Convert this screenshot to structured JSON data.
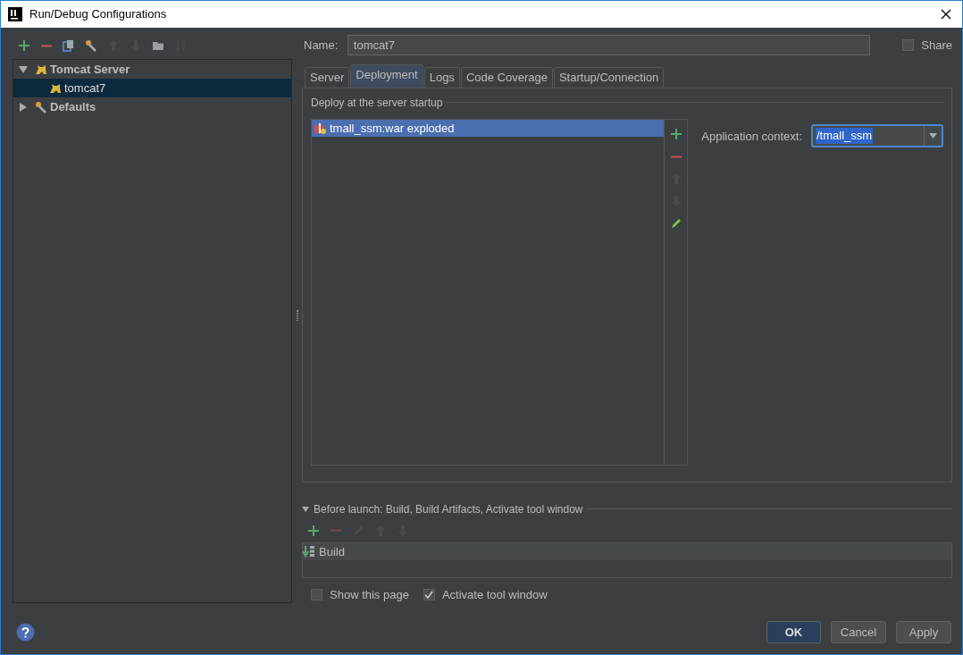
{
  "window": {
    "title": "Run/Debug Configurations"
  },
  "toolbar": [
    {
      "kind": "add",
      "disabled": false
    },
    {
      "kind": "remove",
      "disabled": false
    },
    {
      "kind": "copy",
      "disabled": false
    },
    {
      "kind": "wrench",
      "disabled": false
    },
    {
      "kind": "up",
      "disabled": true
    },
    {
      "kind": "down",
      "disabled": true
    },
    {
      "kind": "folder",
      "disabled": false
    },
    {
      "kind": "sort",
      "disabled": true
    }
  ],
  "tree": [
    {
      "label": "Tomcat Server",
      "kind": "cat",
      "expanded": true,
      "selected": false,
      "children": [
        {
          "label": "tomcat7",
          "kind": "cat",
          "selected": true
        }
      ]
    },
    {
      "label": "Defaults",
      "kind": "wrench",
      "expanded": false,
      "selected": false
    }
  ],
  "name_field": {
    "label": "Name:",
    "value": "tomcat7"
  },
  "share": {
    "label": "Share",
    "checked": false
  },
  "tabs": [
    {
      "label": "Server",
      "selected": false
    },
    {
      "label": "Deployment",
      "selected": true
    },
    {
      "label": "Logs",
      "selected": false
    },
    {
      "label": "Code Coverage",
      "selected": false
    },
    {
      "label": "Startup/Connection",
      "selected": false
    }
  ],
  "deployment": {
    "section_label": "Deploy at the server startup",
    "artifacts": [
      {
        "label": "tmall_ssm:war exploded",
        "selected": true
      }
    ],
    "side_toolbar": [
      {
        "kind": "add",
        "disabled": false
      },
      {
        "kind": "remove",
        "disabled": false
      },
      {
        "kind": "up",
        "disabled": true
      },
      {
        "kind": "down",
        "disabled": true
      },
      {
        "kind": "edit",
        "disabled": false
      }
    ],
    "context_label": "Application context:",
    "context_value": "/tmall_ssm"
  },
  "before_launch": {
    "title": "Before launch: Build, Build Artifacts, Activate tool window",
    "expanded": true,
    "toolbar": [
      {
        "kind": "add",
        "disabled": false
      },
      {
        "kind": "remove",
        "disabled": true
      },
      {
        "kind": "edit",
        "disabled": true
      },
      {
        "kind": "up",
        "disabled": true
      },
      {
        "kind": "down",
        "disabled": true
      }
    ],
    "tasks": [
      {
        "label": "Build"
      }
    ]
  },
  "options": [
    {
      "label": "Show this page",
      "checked": false
    },
    {
      "label": "Activate tool window",
      "checked": true
    }
  ],
  "buttons": [
    {
      "label": "OK",
      "kind": "default"
    },
    {
      "label": "Cancel",
      "kind": "normal"
    },
    {
      "label": "Apply",
      "kind": "normal"
    }
  ]
}
